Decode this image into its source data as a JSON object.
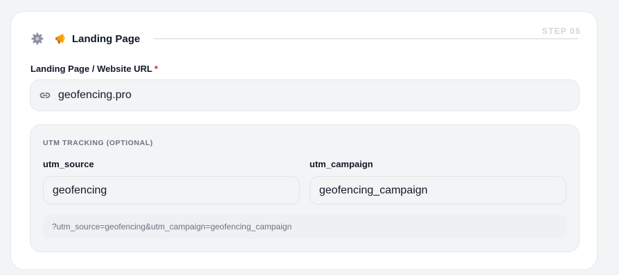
{
  "step": {
    "label": "STEP 05"
  },
  "header": {
    "title": "Landing Page",
    "settings_icon": "gear-icon",
    "title_icon": "megaphone-icon"
  },
  "url": {
    "label": "Landing Page / Website URL",
    "required_mark": "*",
    "icon": "link-icon",
    "value": "geofencing.pro"
  },
  "utm": {
    "heading": "UTM TRACKING (OPTIONAL)",
    "source": {
      "label": "utm_source",
      "value": "geofencing"
    },
    "campaign": {
      "label": "utm_campaign",
      "value": "geofencing_campaign"
    },
    "preview": "?utm_source=geofencing&utm_campaign=geofencing_campaign"
  },
  "colors": {
    "accent": "#f59e0b",
    "required": "#e11d48",
    "field_bg": "#f3f4f6",
    "border": "#e5e7eb"
  }
}
